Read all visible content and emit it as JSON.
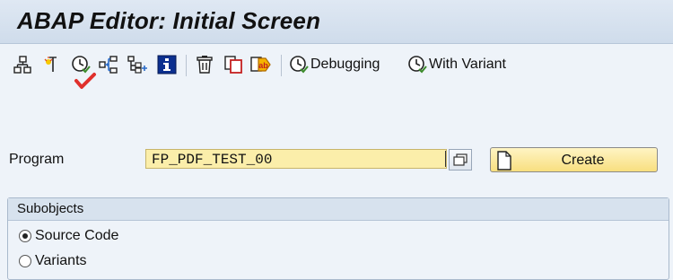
{
  "window": {
    "title": "ABAP Editor: Initial Screen"
  },
  "toolbar": {
    "icons": [
      "hierarchy-icon",
      "where-used-icon",
      "execute-icon",
      "object-list-icon",
      "display-tree-icon",
      "info-icon",
      "delete-icon",
      "copy-icon",
      "rename-icon"
    ],
    "debugging_label": "Debugging",
    "with_variant_label": "With Variant"
  },
  "form": {
    "program_label": "Program",
    "program_value": "FP_PDF_TEST_00",
    "create_label": "Create"
  },
  "subobjects": {
    "title": "Subobjects",
    "options": [
      {
        "label": "Source Code",
        "checked": true
      },
      {
        "label": "Variants",
        "checked": false
      }
    ]
  },
  "colors": {
    "input_bg": "#fbeeaa",
    "create_btn_bg": "#f8df7f",
    "check_mark": "#e0302c"
  }
}
